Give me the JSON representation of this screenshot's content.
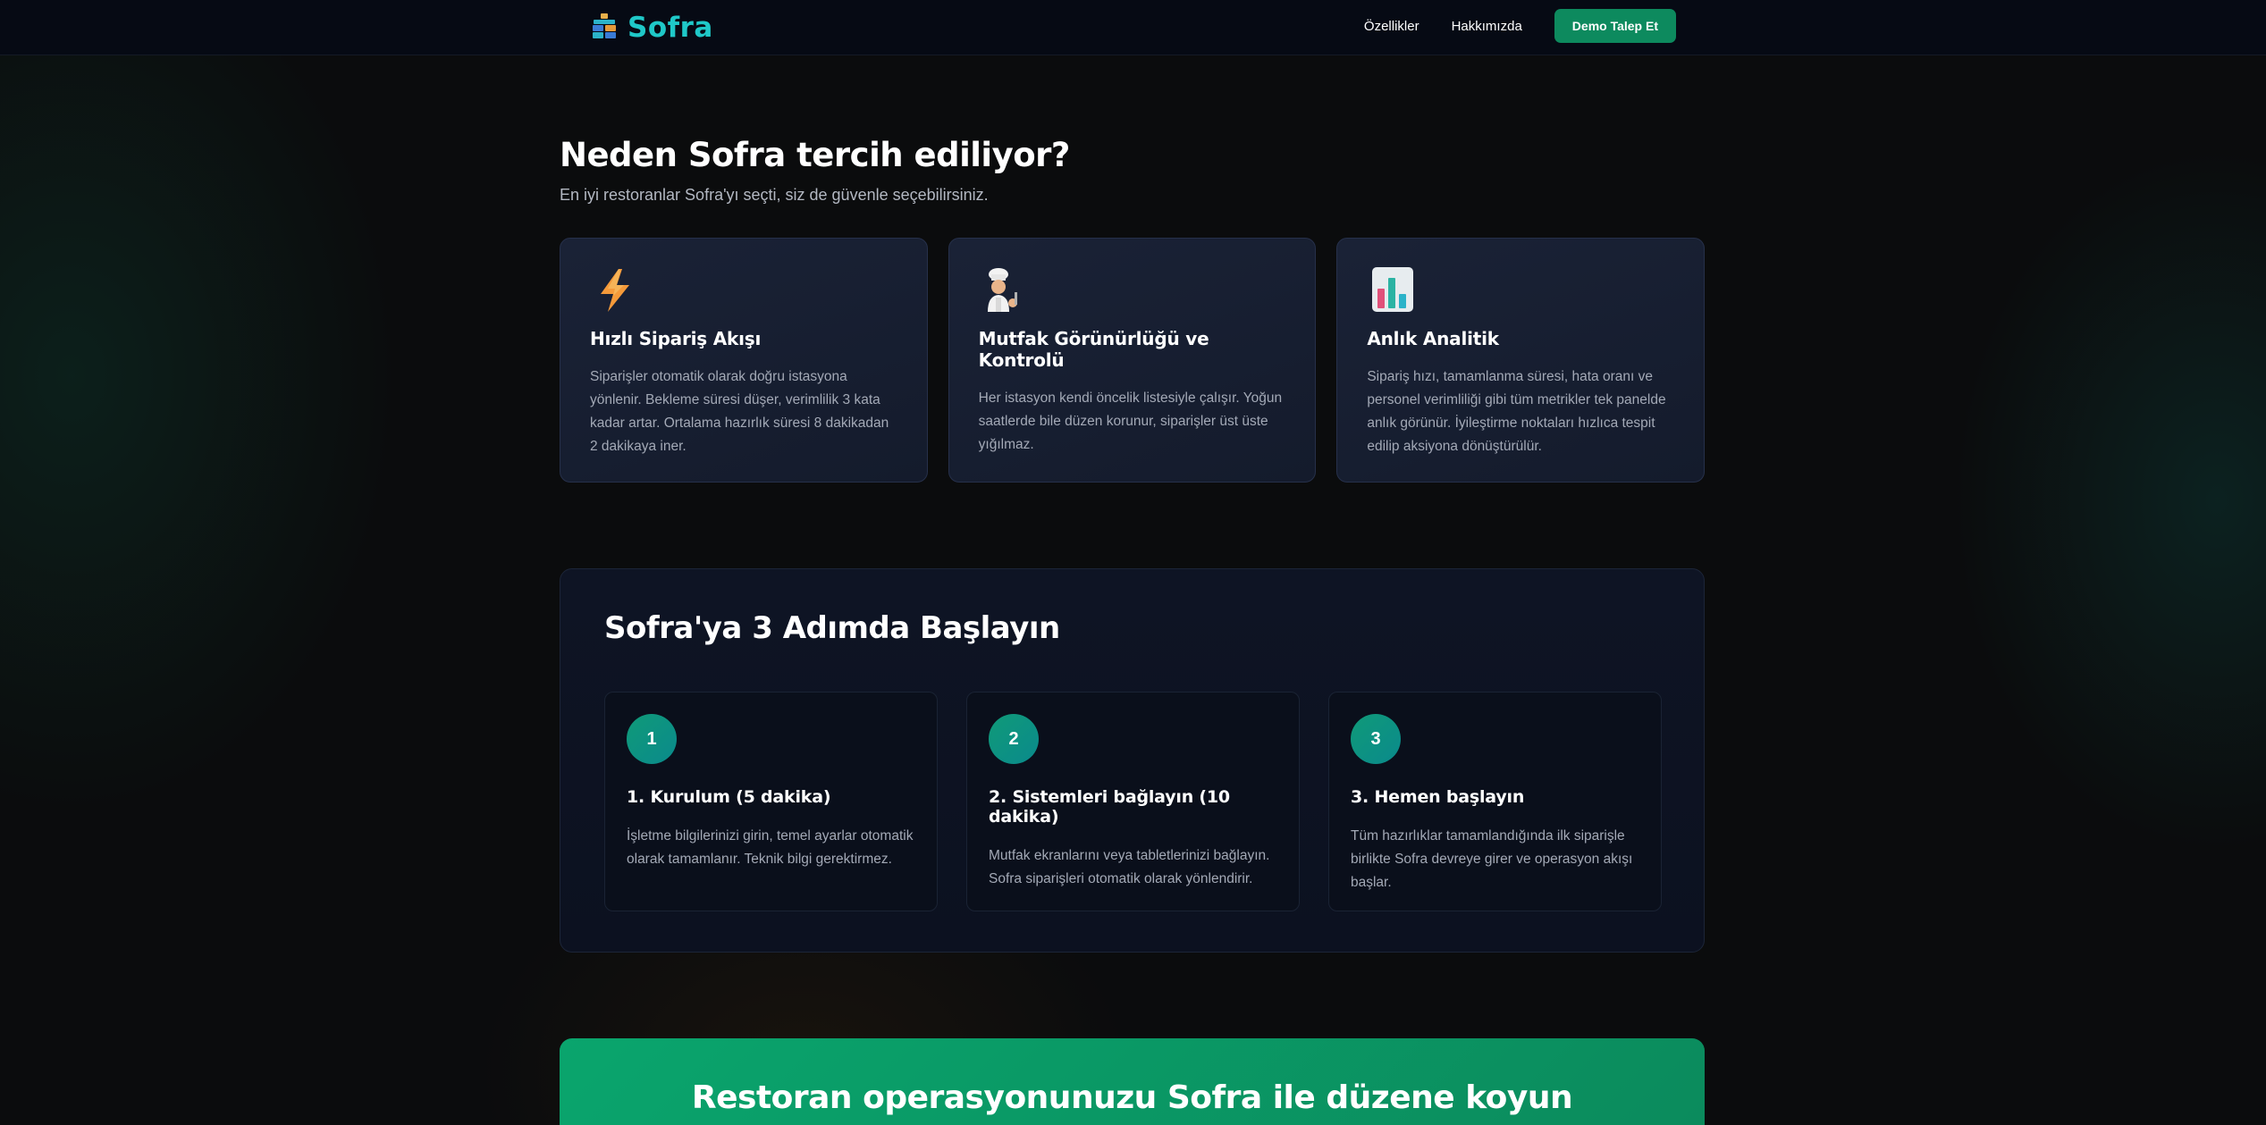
{
  "nav": {
    "brand": "Sofra",
    "links": [
      "Özellikler",
      "Hakkımızda"
    ],
    "demo_label": "Demo Talep Et"
  },
  "features": {
    "title": "Neden Sofra tercih ediliyor?",
    "subtitle": "En iyi restoranlar Sofra'yı seçti, siz de güvenle seçebilirsiniz.",
    "cards": [
      {
        "icon": "lightning-icon",
        "title": "Hızlı Sipariş Akışı",
        "desc": "Siparişler otomatik olarak doğru istasyona yönlenir. Bekleme süresi düşer, verimlilik 3 kata kadar artar. Ortalama hazırlık süresi 8 dakikadan 2 dakikaya iner."
      },
      {
        "icon": "chef-icon",
        "title": "Mutfak Görünürlüğü ve Kontrolü",
        "desc": "Her istasyon kendi öncelik listesiyle çalışır. Yoğun saatlerde bile düzen korunur, siparişler üst üste yığılmaz."
      },
      {
        "icon": "bar-chart-icon",
        "title": "Anlık Analitik",
        "desc": "Sipariş hızı, tamamlanma süresi, hata oranı ve personel verimliliği gibi tüm metrikler tek panelde anlık görünür. İyileştirme noktaları hızlıca tespit edilip aksiyona dönüştürülür."
      }
    ]
  },
  "steps": {
    "title": "Sofra'ya 3 Adımda Başlayın",
    "items": [
      {
        "num": "1",
        "title": "1. Kurulum (5 dakika)",
        "desc": "İşletme bilgilerinizi girin, temel ayarlar otomatik olarak tamamlanır. Teknik bilgi gerektirmez."
      },
      {
        "num": "2",
        "title": "2. Sistemleri bağlayın (10 dakika)",
        "desc": "Mutfak ekranlarını veya tabletlerinizi bağlayın. Sofra siparişleri otomatik olarak yönlendirir."
      },
      {
        "num": "3",
        "title": "3. Hemen başlayın",
        "desc": "Tüm hazırlıklar tamamlandığında ilk siparişle birlikte Sofra devreye girer ve operasyon akışı başlar."
      }
    ]
  },
  "cta": {
    "title": "Restoran operasyonunuzu Sofra ile düzene koyun"
  },
  "colors": {
    "brand": "#1fc8c8",
    "accent": "#0d8a5e",
    "cta": "#0aa56d"
  }
}
